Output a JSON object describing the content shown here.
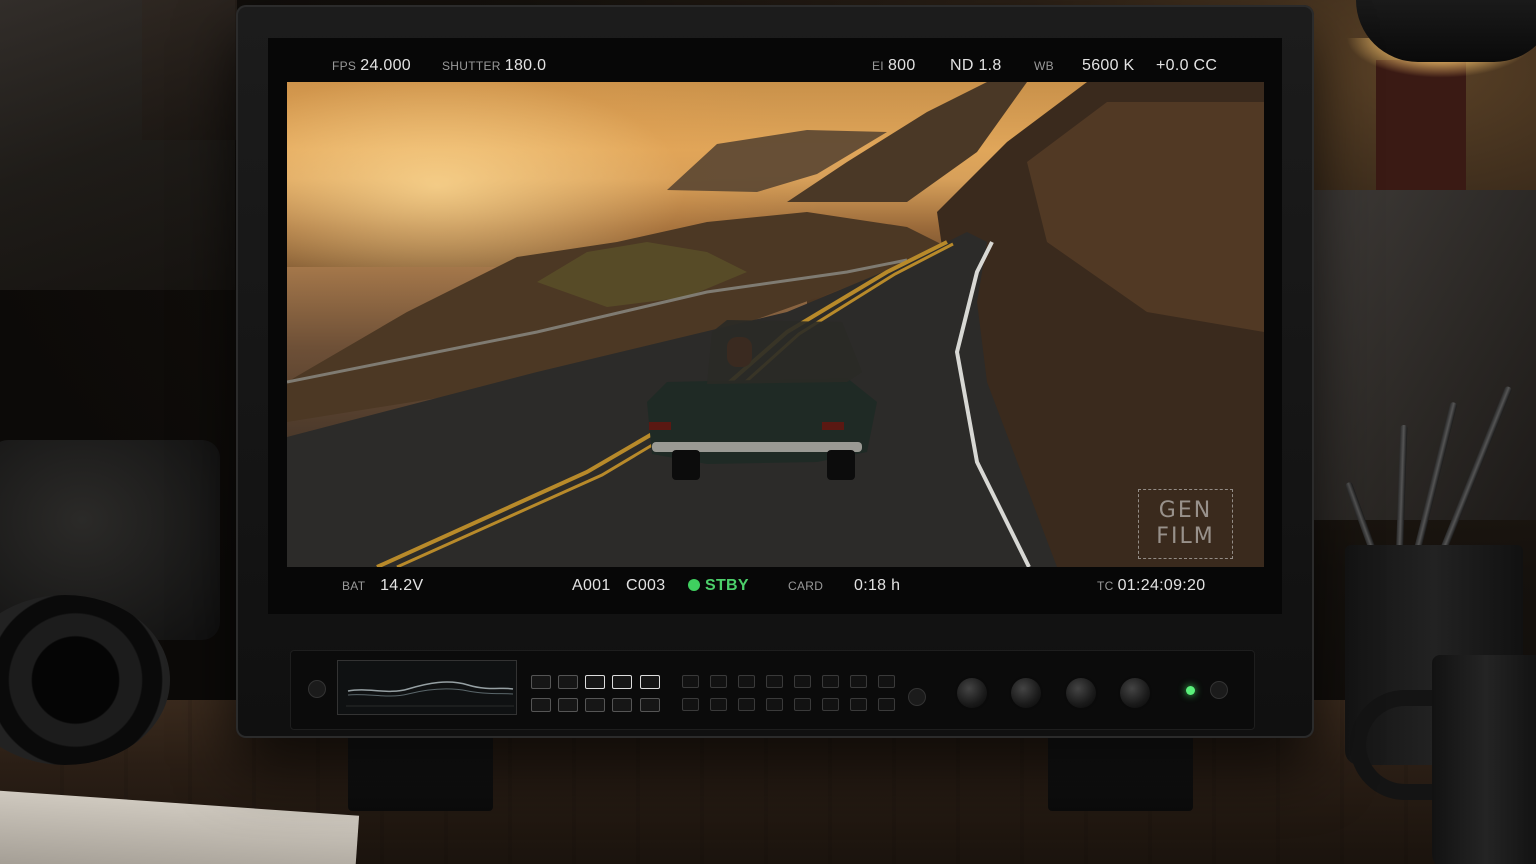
{
  "osd_top": {
    "fps_label": "FPS",
    "fps_value": "24.000",
    "shutter_label": "SHUTTER",
    "shutter_value": "180.0",
    "ei_label": "EI",
    "ei_value": "800",
    "nd_value": "ND 1.8",
    "wb_label": "WB",
    "wb_value": "5600 K",
    "cc_value": "+0.0 CC"
  },
  "osd_bottom": {
    "bat_label": "BAT",
    "bat_value": "14.2V",
    "reel": "A001",
    "clip": "C003",
    "status": "STBY",
    "card_label": "CARD",
    "card_value": "0:18 h",
    "tc_label": "TC",
    "tc_value": "01:24:09:20"
  },
  "watermark": {
    "line1": "GEN",
    "line2": "FILM"
  },
  "colors": {
    "status_green": "#4ccf6a",
    "accent_gold": "#e0a65a"
  },
  "icons": [
    "record-status-dot-icon",
    "power-led-icon"
  ]
}
